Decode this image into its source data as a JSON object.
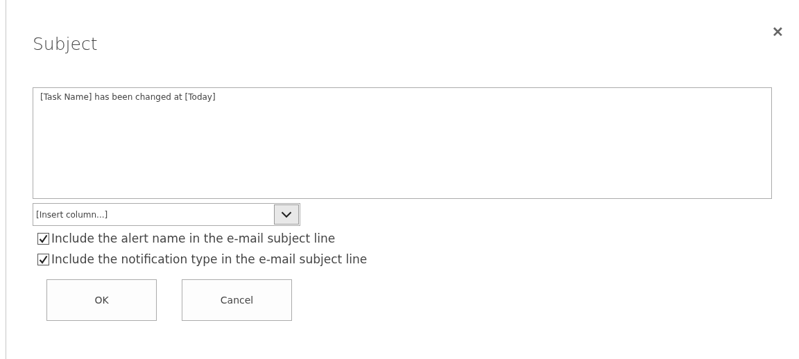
{
  "dialog": {
    "title": "Subject",
    "close": "✕"
  },
  "subject": {
    "value": "[Task Name] has been changed at [Today]"
  },
  "insert_column": {
    "value": "[Insert column...]"
  },
  "options": [
    {
      "label": "Include the alert name in the e-mail subject line",
      "checked": true
    },
    {
      "label": "Include the notification type in the e-mail subject line",
      "checked": true
    }
  ],
  "buttons": [
    "OK",
    "Cancel"
  ]
}
